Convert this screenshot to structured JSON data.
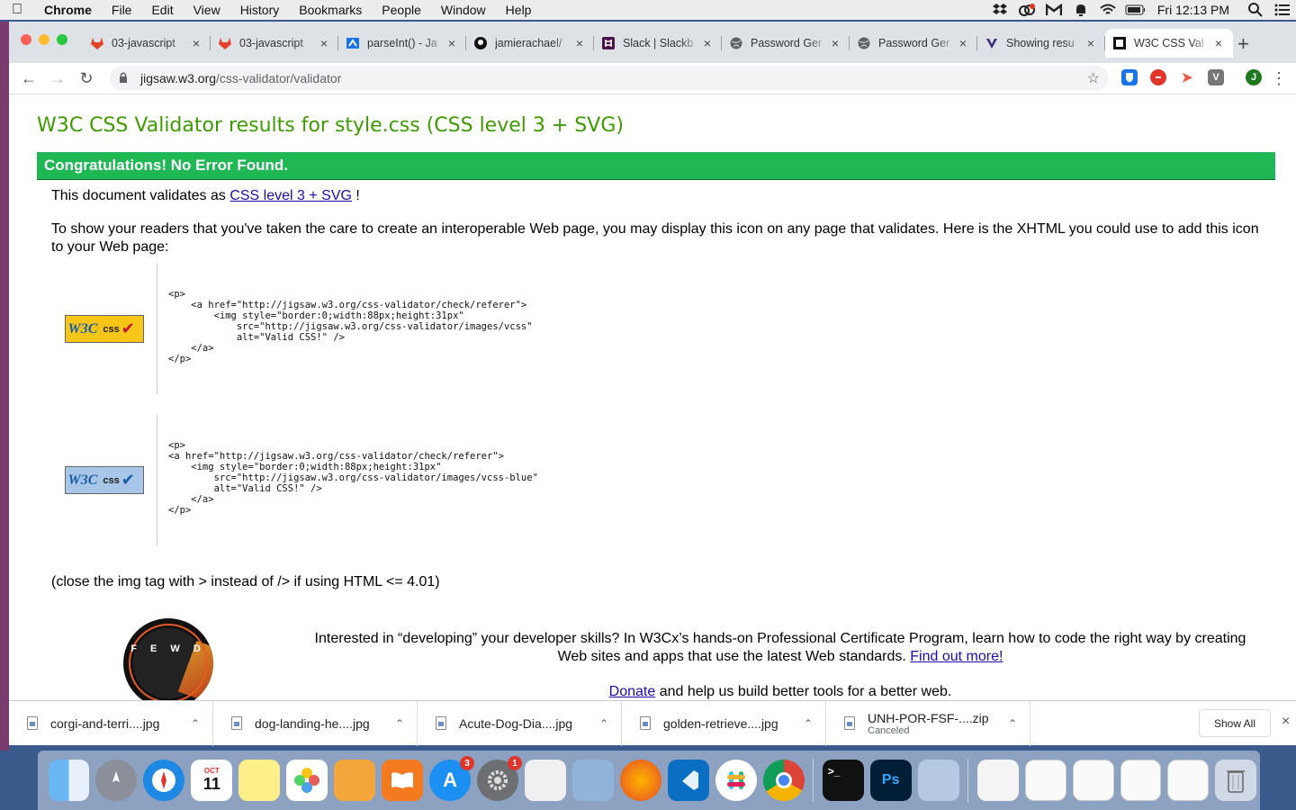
{
  "menubar": {
    "app": "Chrome",
    "items": [
      "File",
      "Edit",
      "View",
      "History",
      "Bookmarks",
      "People",
      "Window",
      "Help"
    ],
    "clock": "Fri 12:13 PM"
  },
  "tabs": [
    {
      "title": "03-javascript",
      "icon": "gitlab-icon"
    },
    {
      "title": "03-javascript",
      "icon": "gitlab-icon"
    },
    {
      "title": "parseInt() - Ja",
      "icon": "mdn-icon"
    },
    {
      "title": "jamierachael/",
      "icon": "github-icon"
    },
    {
      "title": "Slack | Slackb",
      "icon": "slack-icon"
    },
    {
      "title": "Password Ger",
      "icon": "globe-icon"
    },
    {
      "title": "Password Ger",
      "icon": "globe-icon"
    },
    {
      "title": "Showing resu",
      "icon": "search-result-icon"
    },
    {
      "title": "W3C CSS Val",
      "icon": "w3c-icon"
    }
  ],
  "toolbar": {
    "url_host": "jigsaw.w3.org",
    "url_path": "/css-validator/validator",
    "profile_initial": "J"
  },
  "page": {
    "title": "W3C CSS Validator results for style.css (CSS level 3 + SVG)",
    "congrats": "Congratulations! No Error Found.",
    "validates_prefix": "This document validates as",
    "validates_link": "CSS level 3 + SVG",
    "validates_suffix": "!",
    "show_text": "To show your readers that you've taken the care to create an interoperable Web page, you may display this icon on any page that validates. Here is the XHTML you could use to add this icon to your Web page:",
    "code1": "<p>\n    <a href=\"http://jigsaw.w3.org/css-validator/check/referer\">\n        <img style=\"border:0;width:88px;height:31px\"\n            src=\"http://jigsaw.w3.org/css-validator/images/vcss\"\n            alt=\"Valid CSS!\" />\n    </a>\n</p>",
    "code2": "<p>\n<a href=\"http://jigsaw.w3.org/css-validator/check/referer\">\n    <img style=\"border:0;width:88px;height:31px\"\n        src=\"http://jigsaw.w3.org/css-validator/images/vcss-blue\"\n        alt=\"Valid CSS!\" />\n    </a>\n</p>",
    "badge_w3c": "W3C",
    "badge_css": "css",
    "close_note": "(close the img tag with > instead of /> if using HTML <= 4.01)",
    "promo_text": "Interested in “developing” your developer skills? In W3Cx’s hands-on Professional Certificate Program, learn how to code the right way by creating Web sites and apps that use the latest Web standards.",
    "promo_link": "Find out more!",
    "donate_link": "Donate",
    "donate_text": "and help us build better tools for a better web.",
    "fewd_letters": "F E W D"
  },
  "downloads": [
    {
      "name": "corgi-and-terri....jpg",
      "status": ""
    },
    {
      "name": "dog-landing-he....jpg",
      "status": ""
    },
    {
      "name": "Acute-Dog-Dia....jpg",
      "status": ""
    },
    {
      "name": "golden-retrieve....jpg",
      "status": ""
    },
    {
      "name": "UNH-POR-FSF-....zip",
      "status": "Canceled"
    }
  ],
  "show_all": "Show All",
  "dock": {
    "calendar_month": "OCT",
    "calendar_day": "11",
    "appstore_badge": "3",
    "settings_badge": "1",
    "photoshop_label": "Ps"
  },
  "colors": {
    "title_green": "#3e9b00",
    "congrats_bg": "#1fb854",
    "link": "#1a0dab"
  }
}
